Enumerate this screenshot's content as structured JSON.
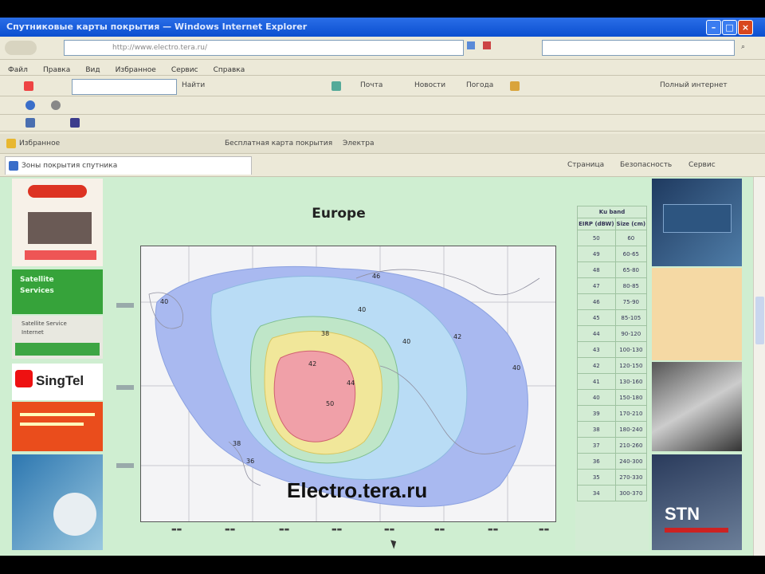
{
  "window": {
    "title": "Спутниковые карты покрытия — Windows Internet Explorer"
  },
  "address": {
    "url": "http://www.electro.tera.ru/",
    "search_placeholder": ""
  },
  "menu": [
    "Файл",
    "Правка",
    "Вид",
    "Избранное",
    "Сервис",
    "Справка"
  ],
  "toolbar": {
    "find_label": "Найти",
    "news_label": "Почта",
    "search_label": "Новости",
    "net_label": "Погода",
    "right_label": "Полный интернет"
  },
  "links_bar": {
    "favorites_label": "Избранное",
    "link1": "Бесплатная карта покрытия",
    "link2": "Электра"
  },
  "tab": {
    "label": "Зоны покрытия спутника",
    "page_label": "Страница",
    "safety_label": "Безопасность",
    "service_label": "Сервис"
  },
  "left_ads": {
    "singtel": "SingTel",
    "ad2_line1": "Satellite",
    "ad2_line2": "Services",
    "ad3_line1": "Satellite Service",
    "ad3_line2": "Internet"
  },
  "map": {
    "title": "Europe",
    "watermark": "Electro.tera.ru"
  },
  "eirp_table": {
    "header": "Ku band",
    "col1": "EIRP (dBW)",
    "col2": "Size (cm)",
    "rows": [
      [
        "50",
        "60"
      ],
      [
        "49",
        "60-65"
      ],
      [
        "48",
        "65-80"
      ],
      [
        "47",
        "80-85"
      ],
      [
        "46",
        "75-90"
      ],
      [
        "45",
        "85-105"
      ],
      [
        "44",
        "90-120"
      ],
      [
        "43",
        "100-130"
      ],
      [
        "42",
        "120-150"
      ],
      [
        "41",
        "130-160"
      ],
      [
        "40",
        "150-180"
      ],
      [
        "39",
        "170-210"
      ],
      [
        "38",
        "180-240"
      ],
      [
        "37",
        "210-260"
      ],
      [
        "36",
        "240-300"
      ],
      [
        "35",
        "270-330"
      ],
      [
        "34",
        "300-370"
      ]
    ]
  },
  "right_ads": {
    "stn": "STN"
  },
  "colors": {
    "page_bg": "#cfeed1",
    "titlebar": "#0b4fd0",
    "zone_inner": "#f0a0a8",
    "zone_mid": "#f1e79a",
    "zone_outer": "#9fb4ee"
  }
}
